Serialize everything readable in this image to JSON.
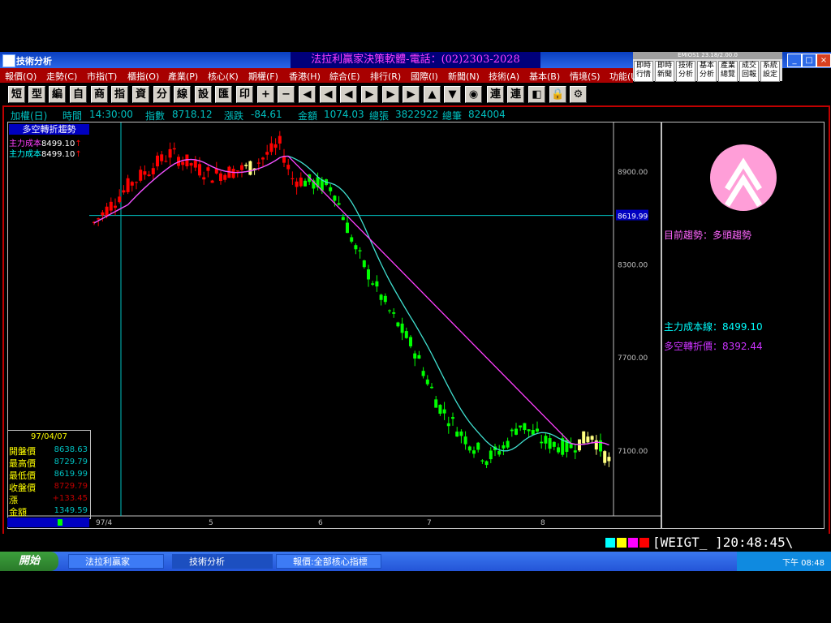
{
  "window": {
    "title": "技術分析",
    "banner": "法拉利贏家決策軟體-電話：(02)2303-2028",
    "quick_header": "EMIOS1 23.18/2.00.0",
    "quick_buttons": [
      "即時行情",
      "即時新聞",
      "技術分析",
      "基本分析",
      "產業總覽",
      "成交回報",
      "系統設定"
    ]
  },
  "menu": [
    "報價(Q)",
    "走勢(C)",
    "市指(T)",
    "櫃指(O)",
    "產業(P)",
    "核心(K)",
    "期權(F)",
    "香港(H)",
    "綜合(E)",
    "排行(R)",
    "國際(I)",
    "新聞(N)",
    "技術(A)",
    "基本(B)",
    "情境(S)",
    "功能(U)"
  ],
  "toolbar": [
    "短",
    "型",
    "編",
    "自",
    "商",
    "指",
    "資",
    "分",
    "線",
    "設",
    "匯",
    "印",
    "+",
    "−",
    "◀",
    "◀",
    "◀",
    "▶",
    "▶",
    "▶",
    "▲",
    "▼",
    "◉",
    "連",
    "連",
    "◧",
    "🔒",
    "⚙"
  ],
  "infobar": {
    "name": "加權(日)",
    "time_label": "時間",
    "time": "14:30:00",
    "index_label": "指數",
    "index": "8718.12",
    "chg_label": "漲跌",
    "chg": "-84.61",
    "amt_label": "金額",
    "amt": "1074.03",
    "vol_label": "總張",
    "vol": "3822922",
    "trades_label": "總筆",
    "trades": "824004"
  },
  "legend": {
    "title": "多空轉折趨勢",
    "line1": "主力成本",
    "val1": "8499.10",
    "line2": "主力成本",
    "val2": "8499.10"
  },
  "stats": {
    "date": "97/04/07",
    "rows": [
      {
        "label": "開盤價",
        "value": "8638.63",
        "color": "#00c0c0"
      },
      {
        "label": "最高價",
        "value": "8729.79",
        "color": "#00c0c0"
      },
      {
        "label": "最低價",
        "value": "8619.99",
        "color": "#00c0c0"
      },
      {
        "label": "收盤價",
        "value": "8729.79",
        "color": "#c00000"
      },
      {
        "label": "漲",
        "value": "+133.45",
        "color": "#c00000"
      },
      {
        "label": "金額",
        "value": "1349.59",
        "color": "#00c0c0"
      }
    ]
  },
  "right_panel": {
    "trend_label": "目前趨勢：多頭趨勢",
    "cost_line": "主力成本線：8499.10",
    "turn_price": "多空轉折價：8392.44"
  },
  "chart_data": {
    "type": "candlestick",
    "yticks": [
      8900,
      8300,
      7700,
      7100
    ],
    "ytick_labels": [
      "8900.00",
      "8300.00",
      "7700.00",
      "7100.00"
    ],
    "ylim": [
      6680,
      9220
    ],
    "cursor_value": "8619.99",
    "cursor_y": 8619.99,
    "xtick_labels": [
      "97/4",
      "5",
      "6",
      "7",
      "8"
    ]
  },
  "status": {
    "clock": "[WEIGT_ ]20:48:45\\"
  },
  "taskbar": {
    "start": "開始",
    "tasks": [
      "法拉利贏家",
      "技術分析",
      "報價:全部核心指標"
    ],
    "time": "下午 08:48"
  }
}
